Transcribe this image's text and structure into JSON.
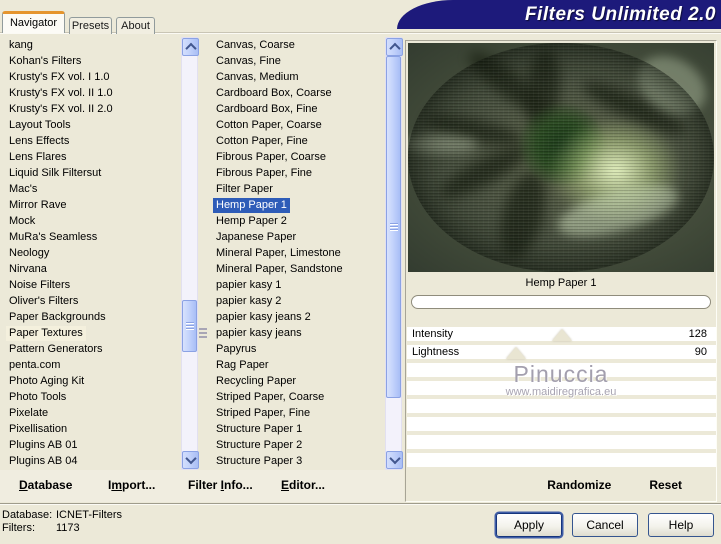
{
  "title": "Filters Unlimited 2.0",
  "tabs": [
    {
      "label": "Navigator",
      "active": true
    },
    {
      "label": "Presets",
      "active": false
    },
    {
      "label": "About",
      "active": false
    }
  ],
  "left_list": {
    "highlighted": "Paper Textures",
    "items": [
      "kang",
      "Kohan's Filters",
      "Krusty's FX vol. I 1.0",
      "Krusty's FX vol. II 1.0",
      "Krusty's FX vol. II 2.0",
      "Layout Tools",
      "Lens Effects",
      "Lens Flares",
      "Liquid Silk Filtersut",
      "Mac's",
      "Mirror Rave",
      "Mock",
      "MuRa's Seamless",
      "Neology",
      "Nirvana",
      "Noise Filters",
      "Oliver's Filters",
      "Paper Backgrounds",
      "Paper Textures",
      "Pattern Generators",
      "penta.com",
      "Photo Aging Kit",
      "Photo Tools",
      "Pixelate",
      "Pixellisation",
      "Plugins AB 01",
      "Plugins AB 04"
    ]
  },
  "filter_list": {
    "selected": "Hemp Paper 1",
    "items": [
      "Canvas, Coarse",
      "Canvas, Fine",
      "Canvas, Medium",
      "Cardboard Box, Coarse",
      "Cardboard Box, Fine",
      "Cotton Paper, Coarse",
      "Cotton Paper, Fine",
      "Fibrous Paper, Coarse",
      "Fibrous Paper, Fine",
      "Filter Paper",
      "Hemp Paper 1",
      "Hemp Paper 2",
      "Japanese Paper",
      "Mineral Paper, Limestone",
      "Mineral Paper, Sandstone",
      "papier kasy 1",
      "papier kasy 2",
      "papier kasy jeans 2",
      "papier kasy jeans",
      "Papyrus",
      "Rag Paper",
      "Recycling Paper",
      "Striped Paper, Coarse",
      "Striped Paper, Fine",
      "Structure Paper 1",
      "Structure Paper 2",
      "Structure Paper 3"
    ]
  },
  "preview": {
    "caption": "Hemp Paper 1"
  },
  "sliders": [
    {
      "label": "Intensity",
      "value": 128,
      "max": 255
    },
    {
      "label": "Lightness",
      "value": 90,
      "max": 255
    }
  ],
  "watermark": {
    "line1": "Pinuccia",
    "line2": "www.maidiregrafica.eu"
  },
  "actions": {
    "database": {
      "label": "Database",
      "accel": 0
    },
    "import": {
      "label": "Import...",
      "accel": 1
    },
    "filter_info": {
      "label": "Filter Info...",
      "accel": 7
    },
    "editor": {
      "label": "Editor...",
      "accel": 0
    },
    "randomize": {
      "label": "Randomize"
    },
    "reset": {
      "label": "Reset"
    }
  },
  "status": {
    "database_label": "Database:",
    "database_value": "ICNET-Filters",
    "filters_label": "Filters:",
    "filters_value": "1173"
  },
  "buttons": {
    "apply": "Apply",
    "cancel": "Cancel",
    "help": "Help"
  },
  "colors": {
    "banner_bg": "#1d1a7b",
    "selection_bg": "#2e5cb8",
    "selection_text": "#ffffff",
    "tab_accent": "#e5952e",
    "dialog_bg": "#ece9d8"
  }
}
